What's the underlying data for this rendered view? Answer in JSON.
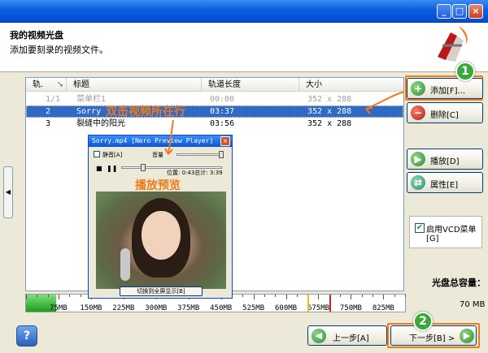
{
  "header": {
    "title": "我的视频光盘",
    "subtitle": "添加要刻录的视频文件。"
  },
  "window_buttons": [
    "_",
    "□",
    "×"
  ],
  "list": {
    "columns": [
      "轨.",
      "标题",
      "轨道长度",
      "大小"
    ],
    "rows": [
      {
        "track": "1/1",
        "title": "菜单栏1",
        "length": "00:00",
        "size": "352 x 288",
        "state": "dim"
      },
      {
        "track": "2",
        "title": "Sorry",
        "length": "03:37",
        "size": "352 x 288",
        "state": "selected"
      },
      {
        "track": "3",
        "title": "裂缝中的阳光",
        "length": "03:56",
        "size": "352 x 288",
        "state": "normal"
      }
    ]
  },
  "buttons": {
    "add": "添加[F]...",
    "delete": "删除[C]",
    "play": "播放[D]",
    "properties": "属性[E]",
    "back": "上一步[A]",
    "next": "下一步[B] >"
  },
  "vcd_menu": {
    "label": "启用VCD菜单",
    "hotkey": "[G]",
    "checked": true
  },
  "capacity": {
    "label": "光盘总容量：",
    "value": "70 MB",
    "ticks": [
      "75MB",
      "150MB",
      "225MB",
      "300MB",
      "375MB",
      "450MB",
      "525MB",
      "600MB",
      "675MB",
      "750MB",
      "825MB"
    ],
    "used_mb": 70
  },
  "preview": {
    "title": "Sorry.mp4 [Nero Preview Player]",
    "mute": "静音[A]",
    "volume": "音量",
    "position": "位置: 0:43总计: 3:39",
    "fullscreen": "切换到全屏显示[B]"
  },
  "annotations": {
    "double_click": "双击视频所在行",
    "preview_note": "播放预览",
    "badge1": "1",
    "badge2": "2"
  },
  "colors": {
    "highlight": "#f07a1a",
    "selection": "#316ac5",
    "badge": "#3aa83a"
  }
}
